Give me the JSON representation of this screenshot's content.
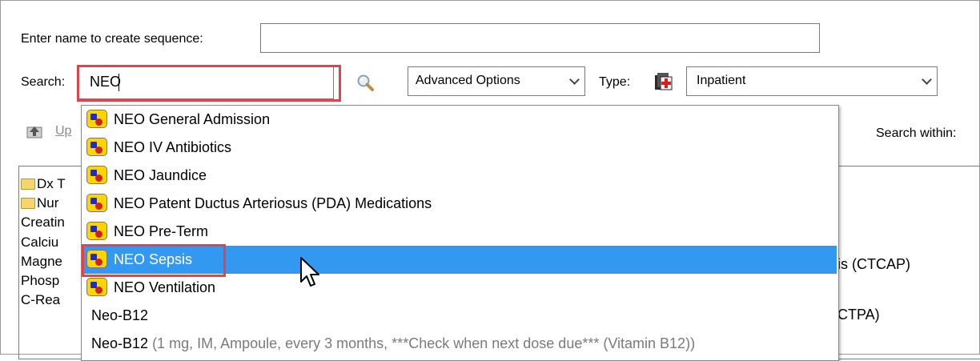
{
  "form": {
    "name_label": "Enter name to create sequence:",
    "name_value": "",
    "search_label": "Search:",
    "search_value": "NEO",
    "advanced_label": "Advanced Options",
    "type_label": "Type:",
    "type_value": "Inpatient"
  },
  "toolbar": {
    "up_label": "Up",
    "search_within_label": "Search within:"
  },
  "tree": {
    "items": [
      {
        "icon": "folder-icon",
        "label": "Dx T"
      },
      {
        "icon": "folder-icon",
        "label": "Nur"
      },
      {
        "icon": "",
        "label": "Creatin"
      },
      {
        "icon": "",
        "label": "Calciu"
      },
      {
        "icon": "",
        "label": "Magne"
      },
      {
        "icon": "",
        "label": "Phosp"
      },
      {
        "icon": "",
        "label": "C-Rea"
      }
    ],
    "right_fragments": [
      "is (CTCAP)",
      "CTPA)"
    ]
  },
  "dropdown": {
    "items": [
      {
        "icon": "powerplan-icon",
        "label": "NEO General Admission"
      },
      {
        "icon": "powerplan-icon",
        "label": "NEO IV Antibiotics"
      },
      {
        "icon": "powerplan-icon",
        "label": "NEO Jaundice"
      },
      {
        "icon": "powerplan-icon",
        "label": "NEO Patent Ductus Arteriosus (PDA) Medications"
      },
      {
        "icon": "powerplan-icon",
        "label": "NEO Pre-Term"
      },
      {
        "icon": "powerplan-icon",
        "label": "NEO Sepsis",
        "selected": true
      },
      {
        "icon": "powerplan-icon",
        "label": "NEO Ventilation"
      },
      {
        "icon": "",
        "label": "Neo-B12"
      },
      {
        "icon": "",
        "label": "Neo-B12",
        "detail": "(1 mg, IM, Ampoule, every 3 months, ***Check when next dose due*** (Vitamin B12))"
      }
    ]
  },
  "colors": {
    "highlight": "#e0434b",
    "selection": "#3399f0"
  }
}
